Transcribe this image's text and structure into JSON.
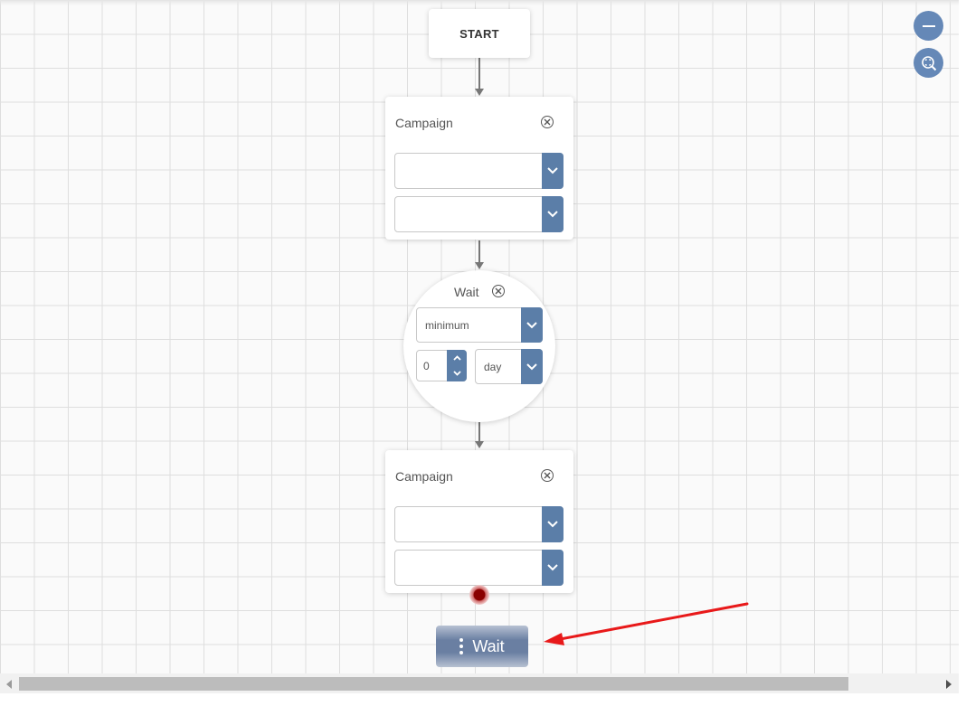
{
  "start_node": {
    "label": "START"
  },
  "campaign_nodes": [
    {
      "title": "Campaign",
      "select1_value": "",
      "select2_value": ""
    },
    {
      "title": "Campaign",
      "select1_value": "",
      "select2_value": ""
    }
  ],
  "wait_node": {
    "title": "Wait",
    "mode_value": "minimum",
    "amount_value": "0",
    "unit_value": "day"
  },
  "toolbox": {
    "wait_label": "Wait"
  },
  "zoom": {
    "zoom_out_icon": "minus-icon",
    "zoom_fit_icon": "zoom-fit-icon"
  },
  "colors": {
    "accent": "#5b7ea8",
    "zoom_button": "#6588b7",
    "endpoint": "#8a0000",
    "annotation_arrow": "#e8191a"
  }
}
